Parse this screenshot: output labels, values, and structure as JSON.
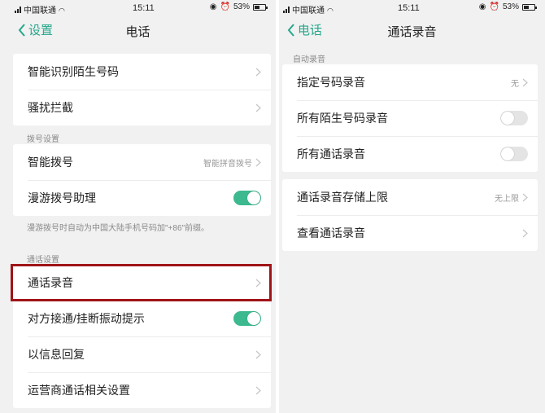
{
  "statusbar": {
    "carrier": "中国联通",
    "time": "15:11",
    "battery": "53%",
    "battery_level": 0.53,
    "icons": [
      "signal-icon",
      "wifi-icon",
      "location-icon",
      "alarm-icon",
      "battery-icon"
    ]
  },
  "left": {
    "back_label": "设置",
    "title": "电话",
    "group1": [
      {
        "label": "智能识别陌生号码"
      },
      {
        "label": "骚扰拦截"
      }
    ],
    "dial_header": "拨号设置",
    "group2": [
      {
        "label": "智能拨号",
        "value": "智能拼音拨号"
      },
      {
        "label": "漫游拨号助理",
        "toggle": "on"
      }
    ],
    "roaming_note": "漫游拨号时自动为中国大陆手机号码加\"+86\"前缀。",
    "call_header": "通话设置",
    "group3": [
      {
        "label": "通话录音"
      },
      {
        "label": "对方接通/挂断振动提示",
        "toggle": "on"
      },
      {
        "label": "以信息回复"
      },
      {
        "label": "运营商通话相关设置"
      }
    ]
  },
  "right": {
    "back_label": "电话",
    "title": "通话录音",
    "auto_header": "自动录音",
    "group1": [
      {
        "label": "指定号码录音",
        "value": "无"
      },
      {
        "label": "所有陌生号码录音",
        "toggle": "off"
      },
      {
        "label": "所有通话录音",
        "toggle": "off"
      }
    ],
    "group2": [
      {
        "label": "通话录音存储上限",
        "value": "无上限"
      },
      {
        "label": "查看通话录音"
      }
    ]
  },
  "colors": {
    "accent": "#25a78b",
    "toggle_on": "#3cb98f",
    "highlight": "#a01418",
    "background": "#f1f1f1"
  }
}
